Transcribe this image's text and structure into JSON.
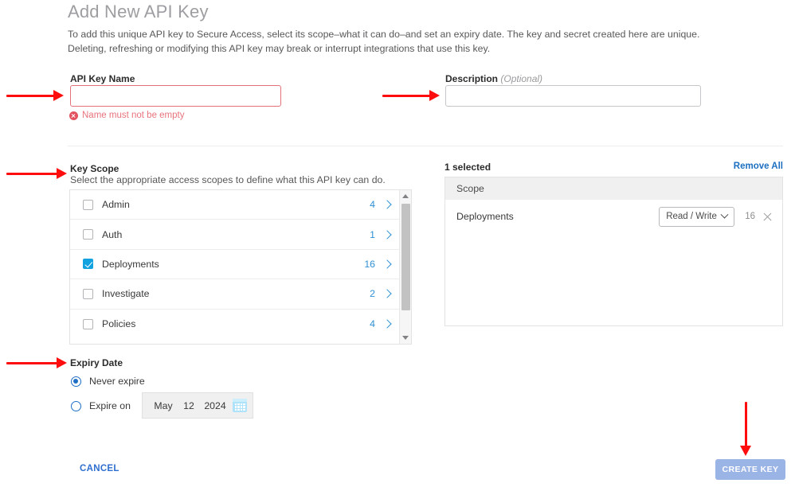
{
  "header": {
    "title": "Add New API Key",
    "intro_line1": "To add this unique API key to Secure Access, select its scope–what it can do–and set an expiry date. The key and secret created here are unique.",
    "intro_line2": "Deleting, refreshing or modifying this API key may break or interrupt integrations that use this key."
  },
  "form": {
    "name_label": "API Key Name",
    "name_value": "",
    "name_error": "Name must not be empty",
    "description_label": "Description",
    "description_optional": "(Optional)",
    "description_value": ""
  },
  "key_scope": {
    "title": "Key Scope",
    "subtitle": "Select the appropriate access scopes to define what this API key can do.",
    "items": [
      {
        "label": "Admin",
        "count": "4",
        "checked": false
      },
      {
        "label": "Auth",
        "count": "1",
        "checked": false
      },
      {
        "label": "Deployments",
        "count": "16",
        "checked": true
      },
      {
        "label": "Investigate",
        "count": "2",
        "checked": false
      },
      {
        "label": "Policies",
        "count": "4",
        "checked": false
      }
    ]
  },
  "selected_panel": {
    "count_label": "1 selected",
    "remove_all_label": "Remove All",
    "column_header": "Scope",
    "rows": [
      {
        "name": "Deployments",
        "permission": "Read / Write",
        "count": "16"
      }
    ]
  },
  "expiry": {
    "title": "Expiry Date",
    "never_label": "Never expire",
    "expire_on_label": "Expire on",
    "never_selected": true,
    "date": {
      "month": "May",
      "day": "12",
      "year": "2024"
    }
  },
  "footer": {
    "cancel_label": "CANCEL",
    "create_label": "CREATE KEY"
  },
  "colors": {
    "accent_blue": "#12a2e0",
    "link_blue": "#1d6fc1",
    "error_red": "#e2525f",
    "annotation_red": "#fd0d0d",
    "button_disabled": "#9bb4e6"
  }
}
